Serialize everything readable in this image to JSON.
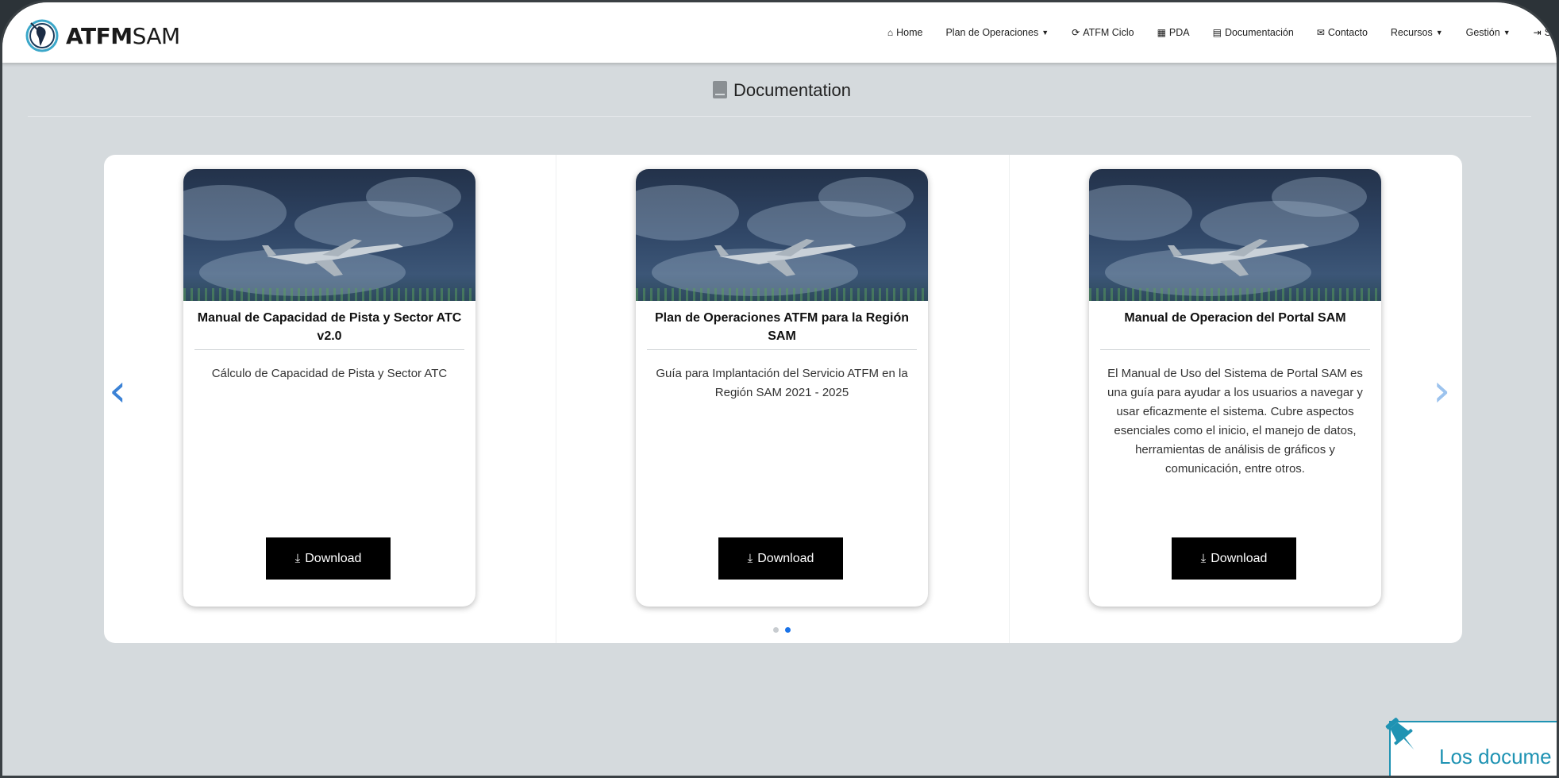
{
  "brand": {
    "bold": "ATFM",
    "light": "SAM"
  },
  "nav": [
    {
      "label": "Home",
      "icon": "home-icon",
      "glyph": "⌂",
      "caret": false
    },
    {
      "label": "Plan de Operaciones",
      "icon": "",
      "glyph": "",
      "caret": true
    },
    {
      "label": "ATFM Ciclo",
      "icon": "refresh-icon",
      "glyph": "⟳",
      "caret": false
    },
    {
      "label": "PDA",
      "icon": "table-icon",
      "glyph": "▦",
      "caret": false
    },
    {
      "label": "Documentación",
      "icon": "book-icon",
      "glyph": "▤",
      "caret": false
    },
    {
      "label": "Contacto",
      "icon": "envelope-icon",
      "glyph": "✉",
      "caret": false
    },
    {
      "label": "Recursos",
      "icon": "",
      "glyph": "",
      "caret": true
    },
    {
      "label": "Gestión",
      "icon": "",
      "glyph": "",
      "caret": true
    },
    {
      "label": "Sa",
      "icon": "sign-out-icon",
      "glyph": "⇥",
      "caret": false
    }
  ],
  "page": {
    "title": "Documentation"
  },
  "cards": [
    {
      "title": "Manual de Capacidad de Pista y Sector ATC v2.0",
      "description": "Cálculo de Capacidad de Pista y Sector ATC",
      "button": "Download"
    },
    {
      "title": "Plan de Operaciones ATFM para la Región SAM",
      "description": "Guía para Implantación del Servicio ATFM en la Región SAM 2021 - 2025",
      "button": "Download"
    },
    {
      "title": "Manual de Operacion del Portal SAM",
      "description": "El Manual de Uso del Sistema de Portal SAM es una guía para ayudar a los usuarios a navegar y usar eficazmente el sistema. Cubre aspectos esenciales como el inicio, el manejo de datos, herramientas de análisis de gráficos y comunicación, entre otros.",
      "button": "Download"
    }
  ],
  "carousel": {
    "dots": 2,
    "active_dot": 2
  },
  "note": {
    "text": "Los docume"
  },
  "colors": {
    "accent": "#1a73e8",
    "note": "#1f93b3",
    "button": "#000000"
  }
}
